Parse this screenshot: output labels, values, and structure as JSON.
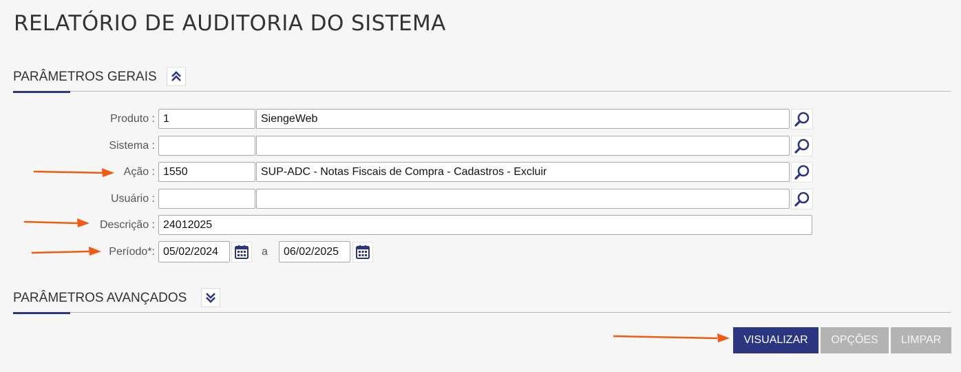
{
  "page_title": "RELATÓRIO DE AUDITORIA DO SISTEMA",
  "sections": {
    "general": {
      "title": "PARÂMETROS GERAIS",
      "toggle_icon": "double-chevron-up-icon"
    },
    "advanced": {
      "title": "PARÂMETROS AVANÇADOS",
      "toggle_icon": "double-chevron-down-icon"
    }
  },
  "form": {
    "produto": {
      "label": "Produto :",
      "code": "1",
      "description": "SiengeWeb"
    },
    "sistema": {
      "label": "Sistema :",
      "code": "",
      "description": ""
    },
    "acao": {
      "label": "Ação :",
      "code": "1550",
      "description": "SUP-ADC - Notas Fiscais de Compra - Cadastros - Excluir"
    },
    "usuario": {
      "label": "Usuário :",
      "code": "",
      "description": ""
    },
    "descricao": {
      "label": "Descrição :",
      "value": "24012025"
    },
    "periodo": {
      "label": "Período*:",
      "start": "05/02/2024",
      "separator": "a",
      "end": "06/02/2025"
    }
  },
  "actions": {
    "visualizar": "VISUALIZAR",
    "opcoes": "OPÇÕES",
    "limpar": "LIMPAR"
  },
  "colors": {
    "accent": "#2c3580",
    "annotation_arrow": "#f05a12",
    "disabled_button": "#b3b3b3"
  }
}
